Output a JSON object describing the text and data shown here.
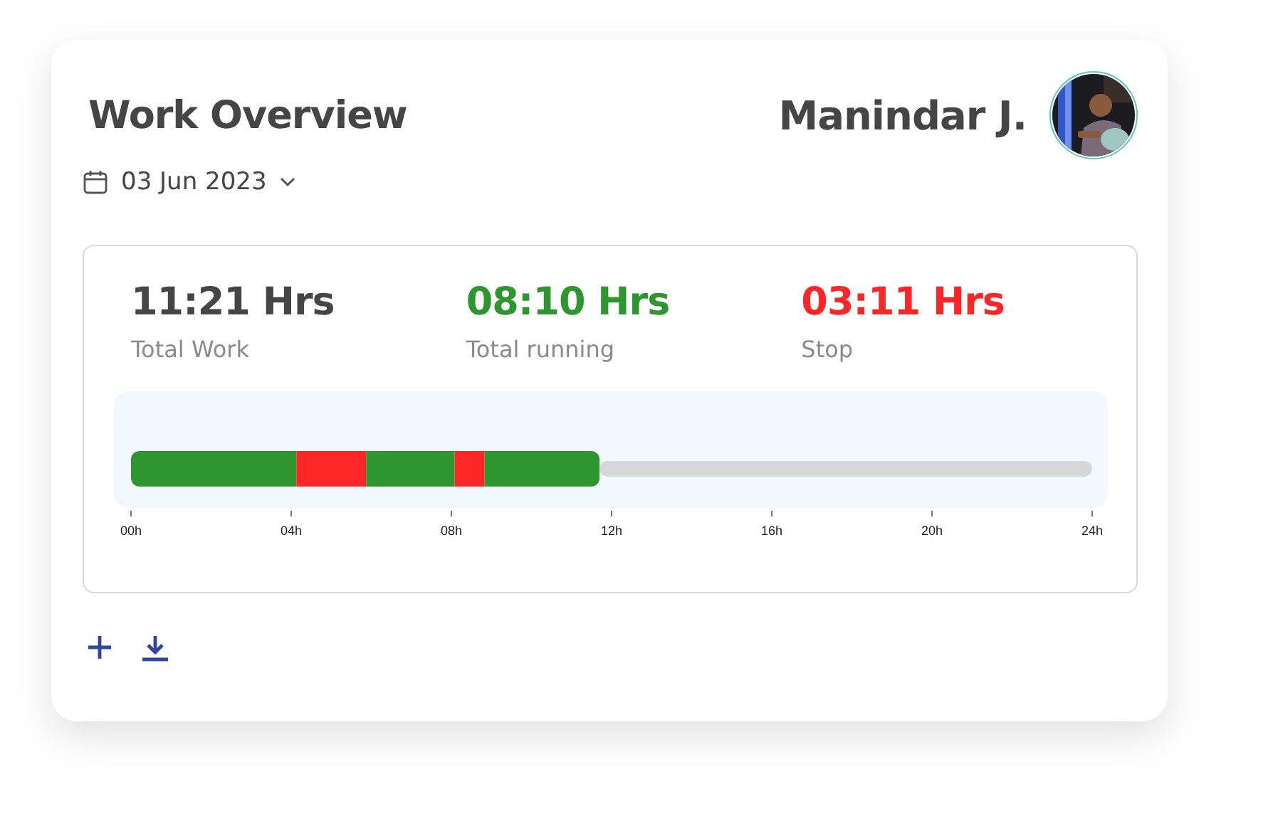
{
  "card": {
    "title": "Work Overview",
    "user": {
      "name": "Manindar J."
    },
    "date": {
      "value": "03 Jun 2023"
    },
    "stats": [
      {
        "kind": "total",
        "value": "11:21 Hrs",
        "label": "Total Work"
      },
      {
        "kind": "running",
        "value": "08:10 Hrs",
        "label": "Total running"
      },
      {
        "kind": "stop",
        "value": "03:11 Hrs",
        "label": "Stop"
      }
    ],
    "timeline": {
      "chart_data": {
        "type": "bar",
        "orientation": "horizontal",
        "stacked": true,
        "series": [
          {
            "color": "#2e962e",
            "values": [
              4.13
            ]
          },
          {
            "color": "#fc2626",
            "values": [
              1.74
            ]
          },
          {
            "color": "#2e962e",
            "values": [
              2.21
            ]
          },
          {
            "color": "#fc2626",
            "values": [
              0.75
            ]
          },
          {
            "color": "#2e962e",
            "values": [
              2.87
            ]
          },
          {
            "color": "#d6d8d7",
            "values": [
              12.3
            ]
          }
        ],
        "xlim": [
          0,
          24
        ],
        "xticks": [
          {
            "value": 0,
            "label": "00h"
          },
          {
            "value": 4,
            "label": "04h"
          },
          {
            "value": 8,
            "label": "08h"
          },
          {
            "value": 12,
            "label": "12h"
          },
          {
            "value": 16,
            "label": "16h"
          },
          {
            "value": 20,
            "label": "20h"
          },
          {
            "value": 24,
            "label": "24h"
          }
        ]
      }
    },
    "actions": [
      {
        "kind": "add"
      },
      {
        "kind": "download"
      }
    ]
  }
}
